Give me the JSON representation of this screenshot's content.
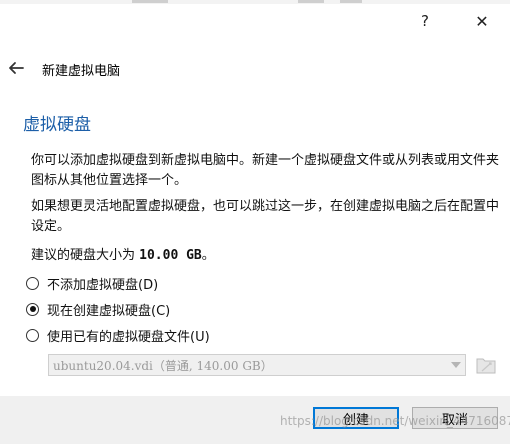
{
  "window": {
    "help_label": "?",
    "close_label": "✕"
  },
  "header": {
    "wizard_title": "新建虚拟电脑"
  },
  "page": {
    "heading": "虚拟硬盘",
    "paragraph1": "你可以添加虚拟硬盘到新虚拟电脑中。新建一个虚拟硬盘文件或从列表或用文件夹图标从其他位置选择一个。",
    "paragraph2": "如果想更灵活地配置虚拟硬盘，也可以跳过这一步，在创建虚拟电脑之后在配置中设定。",
    "recommended_prefix": "建议的硬盘大小为 ",
    "recommended_size": "10.00 GB",
    "recommended_suffix": "。"
  },
  "options": [
    {
      "label": "不添加虚拟硬盘(D)",
      "checked": false
    },
    {
      "label": "现在创建虚拟硬盘(C)",
      "checked": true
    },
    {
      "label": "使用已有的虚拟硬盘文件(U)",
      "checked": false
    }
  ],
  "existing_disk": {
    "selected": "ubuntu20.04.vdi（普通, 140.00 GB）",
    "disabled": true
  },
  "buttons": {
    "create": "创建",
    "cancel": "取消"
  },
  "watermark": "https://blog.csdn.net/weixin_44716087",
  "colors": {
    "heading": "#1d5fa8",
    "primary_border": "#0078d7",
    "button_bar": "#f0f0f0"
  },
  "icons": {
    "back": "arrow-left-icon",
    "folder": "folder-icon",
    "dropdown": "chevron-down-icon"
  }
}
